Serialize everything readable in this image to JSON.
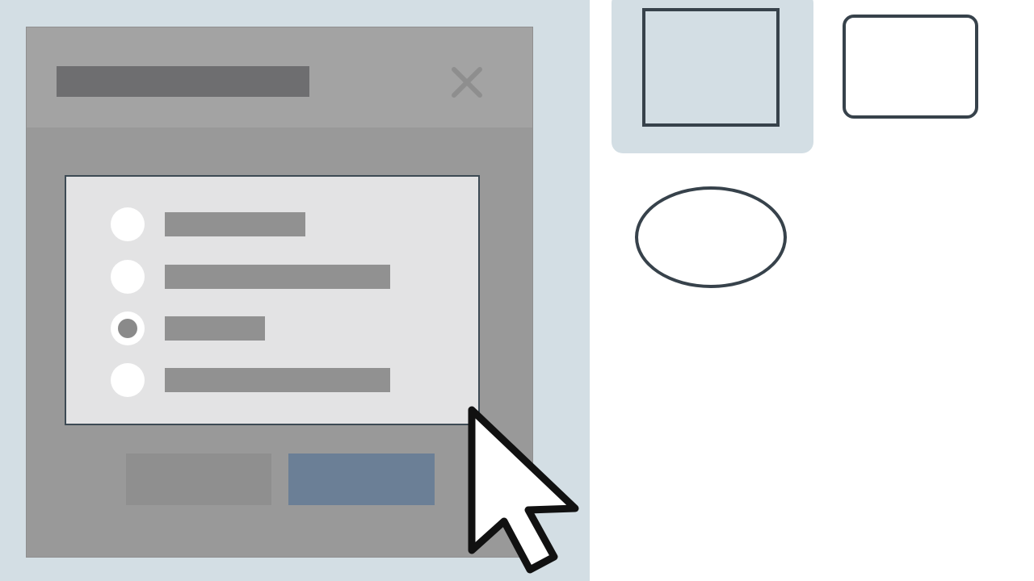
{
  "dialog": {
    "title": "",
    "close_icon": "close-icon",
    "options": [
      {
        "label": "",
        "selected": false
      },
      {
        "label": "",
        "selected": false
      },
      {
        "label": "",
        "selected": true
      },
      {
        "label": "",
        "selected": false
      }
    ],
    "cancel_label": "",
    "ok_label": ""
  },
  "shapes_panel": {
    "items": [
      {
        "shape": "square",
        "selected": true
      },
      {
        "shape": "rounded-rectangle",
        "selected": false
      },
      {
        "shape": "ellipse",
        "selected": false
      }
    ]
  },
  "colors": {
    "background": "#d3dee4",
    "dialog": "#999999",
    "dialog_header": "#a3a3a3",
    "panel": "#e3e3e4",
    "outline": "#37424b",
    "primary_button": "#6b7f96",
    "secondary_button": "#8f8f8f"
  },
  "cursor_icon": "mouse-pointer-icon"
}
